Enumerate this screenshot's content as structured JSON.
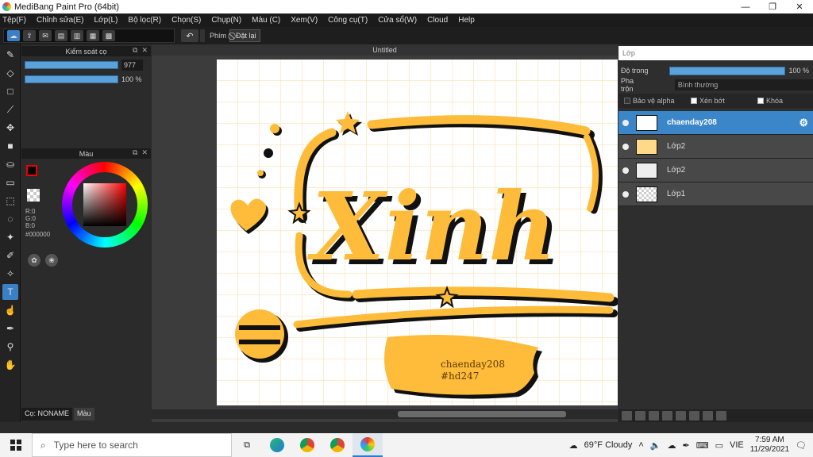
{
  "window": {
    "title": "MediBang Paint Pro (64bit)",
    "min": "—",
    "max": "❐",
    "close": "✕"
  },
  "menu": [
    "Tệp(F)",
    "Chỉnh sửa(E)",
    "Lớp(L)",
    "Bộ lọc(R)",
    "Chọn(S)",
    "Chụp(N)",
    "Màu (C)",
    "Xem(V)",
    "Công cụ(T)",
    "Cửa sổ(W)",
    "Cloud",
    "Help"
  ],
  "toolbar": {
    "key_label": "Phím",
    "reset_label": "Đặt lại"
  },
  "brush_panel": {
    "title": "Kiểm soát cọ",
    "size_value": "977",
    "opacity_value": "100 %",
    "size_fill": 1.0,
    "opacity_fill": 1.0
  },
  "color_panel": {
    "title": "Màu",
    "r": "R:0",
    "g": "G:0",
    "b": "B:0",
    "hex": "#000000",
    "fg": "#000000",
    "bg": "#ffffff"
  },
  "bottom_tabs": {
    "brush_tab": "Cọ: NONAME",
    "color_tab": "Màu"
  },
  "document": {
    "tab_title": "Untitled",
    "main_text": "Xinh",
    "credit_1": "chaenday208",
    "credit_2": "#hd247",
    "accent": "#ffb52e"
  },
  "layers_panel": {
    "title": "Lớp",
    "opacity_label": "Độ trong",
    "opacity_value": "100 %",
    "opacity_fill": 1.0,
    "blend_label": "Pha trộn",
    "blend_value": "Bình thường",
    "protect_alpha": "Bảo vệ alpha",
    "clip": "Xén bớt",
    "lock": "Khóa",
    "layers": [
      {
        "name": "chaenday208",
        "selected": true
      },
      {
        "name": "Lớp2",
        "selected": false
      },
      {
        "name": "Lớp2",
        "selected": false
      },
      {
        "name": "Lớp1",
        "selected": false
      }
    ]
  },
  "taskbar": {
    "search_placeholder": "Type here to search",
    "weather": "69°F Cloudy",
    "lang": "VIE",
    "time": "7:59 AM",
    "date": "11/29/2021"
  }
}
